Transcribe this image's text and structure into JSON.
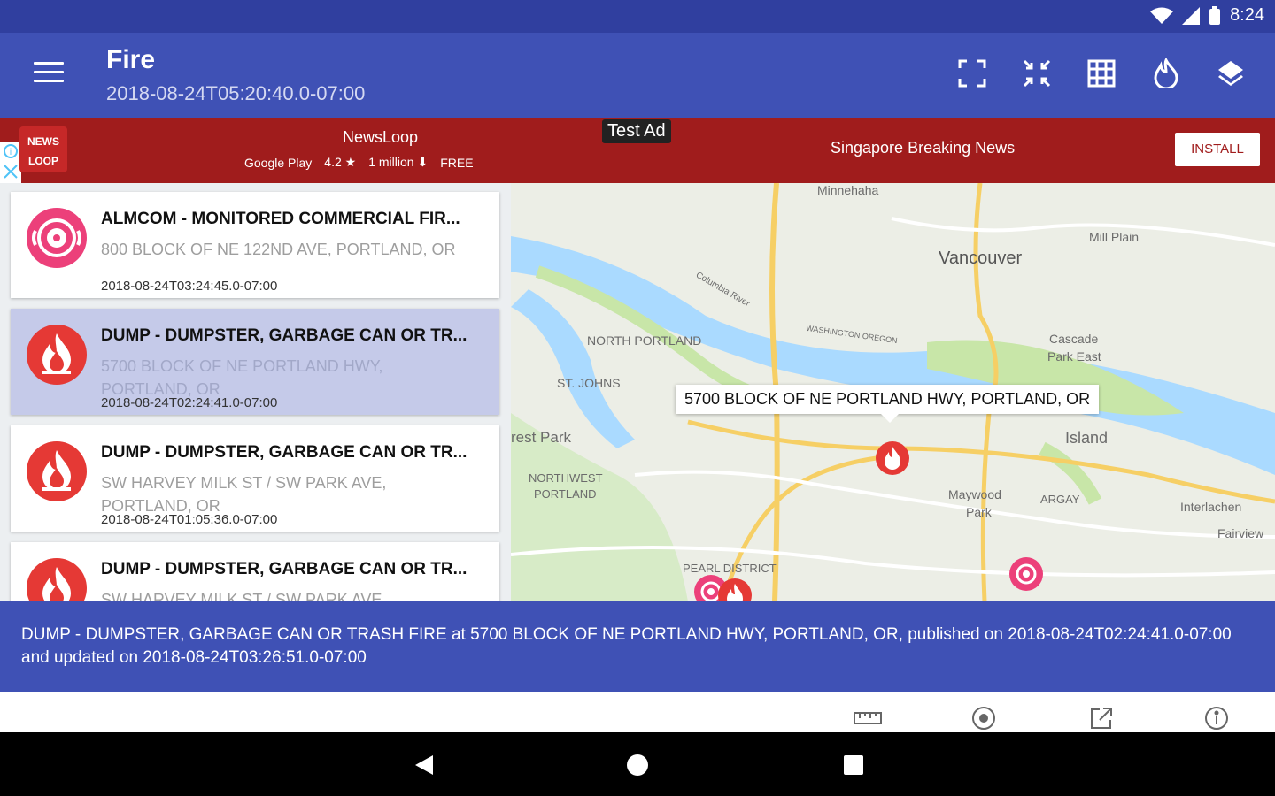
{
  "status_bar": {
    "time": "8:24"
  },
  "app_bar": {
    "menu_icon": "hamburger-menu-icon",
    "title": "Fire",
    "subtitle": "2018-08-24T05:20:40.0-07:00",
    "actions": [
      "fullscreen-icon",
      "fit-bounds-icon",
      "grid-icon",
      "fire-filter-icon",
      "layers-icon"
    ]
  },
  "ad": {
    "logo_line1": "NEWS",
    "logo_line2": "LOOP",
    "app_name": "NewsLoop",
    "store": "Google Play",
    "rating": "4.2",
    "downloads": "1 million",
    "price": "FREE",
    "test_label": "Test Ad",
    "headline": "Singapore Breaking News",
    "install_label": "INSTALL"
  },
  "incidents": [
    {
      "title": "ALMCOM - MONITORED COMMERCIAL FIR...",
      "address": "800 BLOCK OF NE 122ND AVE, PORTLAND, OR",
      "time": "2018-08-24T03:24:45.0-07:00",
      "icon": "alarm-icon",
      "selected": false
    },
    {
      "title": "DUMP - DUMPSTER, GARBAGE CAN OR TR...",
      "address": "5700 BLOCK OF NE PORTLAND HWY, PORTLAND, OR",
      "time": "2018-08-24T02:24:41.0-07:00",
      "icon": "fire-icon",
      "selected": true
    },
    {
      "title": "DUMP - DUMPSTER, GARBAGE CAN OR TR...",
      "address": "SW HARVEY MILK ST / SW PARK AVE, PORTLAND, OR",
      "time": "2018-08-24T01:05:36.0-07:00",
      "icon": "fire-icon",
      "selected": false
    },
    {
      "title": "DUMP - DUMPSTER, GARBAGE CAN OR TR...",
      "address": "SW HARVEY MILK ST / SW PARK AVE,",
      "time": "",
      "icon": "fire-icon",
      "selected": false
    }
  ],
  "map": {
    "callout": "5700 BLOCK OF NE PORTLAND HWY, PORTLAND, OR",
    "labels": {
      "minnehaha": "Minnehaha",
      "vancouver": "Vancouver",
      "mill_plain": "Mill Plain",
      "north_portland": "NORTH PORTLAND",
      "st_johns": "ST. JOHNS",
      "cascade": "Cascade",
      "park_east": "Park East",
      "forest_park": "rest Park",
      "island": "Island",
      "northwest": "NORTHWEST",
      "portland": "PORTLAND",
      "maywood": "Maywood",
      "park": "Park",
      "argay": "ARGAY",
      "interlachen": "Interlachen",
      "fairview": "Fairview",
      "pearl": "PEARL DISTRICT",
      "columbia_river": "Columbia River",
      "washington_oregon": "WASHINGTON OREGON"
    }
  },
  "info_banner": {
    "text": "DUMP - DUMPSTER, GARBAGE CAN OR TRASH FIRE at 5700 BLOCK OF NE PORTLAND HWY, PORTLAND, OR, published on 2018-08-24T02:24:41.0-07:00 and updated on 2018-08-24T03:26:51.0-07:00"
  },
  "bottom_actions": [
    "ruler-icon",
    "my-location-icon",
    "open-external-icon",
    "info-icon"
  ],
  "nav": [
    "back-icon",
    "home-icon",
    "recents-icon"
  ],
  "colors": {
    "primary": "#3f51b5",
    "primary_dark": "#303f9f",
    "selected_row": "#c5cae9",
    "ad_background": "#a01c1c",
    "fire_red": "#e53935",
    "alarm_pink": "#ec407a"
  }
}
